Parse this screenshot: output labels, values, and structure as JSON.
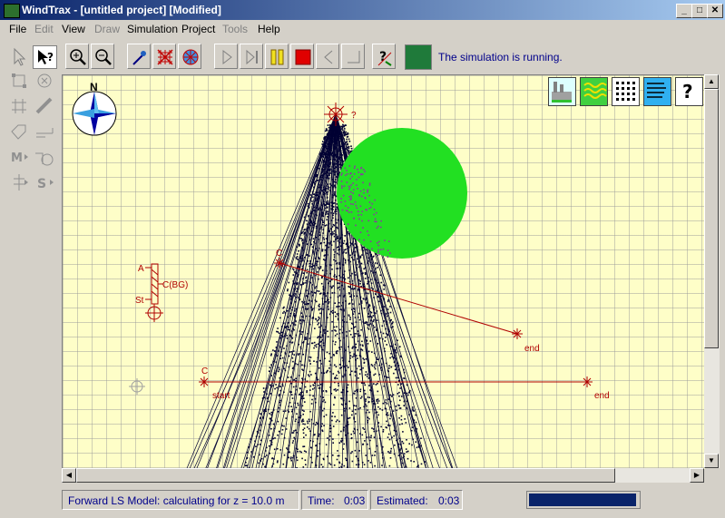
{
  "window": {
    "title": "WindTrax - [untitled project] [Modified]",
    "controls": [
      "_",
      "□",
      "✕"
    ]
  },
  "menu": [
    {
      "label": "File",
      "enabled": true
    },
    {
      "label": "Edit",
      "enabled": false
    },
    {
      "label": "View",
      "enabled": true
    },
    {
      "label": "Draw",
      "enabled": false
    },
    {
      "label": "Simulation",
      "enabled": true
    },
    {
      "label": "Project",
      "enabled": true
    },
    {
      "label": "Tools",
      "enabled": false
    },
    {
      "label": "Help",
      "enabled": true
    }
  ],
  "toolbar": {
    "buttons": [
      "zoom-in-icon",
      "zoom-out-icon",
      "probe-icon",
      "source-grid-icon",
      "sensor-target-icon",
      "play-icon",
      "step-end-icon",
      "pause-icon",
      "stop-icon",
      "step-back-icon",
      "end-icon",
      "help-cursor-icon"
    ],
    "status_message": "The simulation is running.",
    "status_color": "#1f7a3a"
  },
  "left_tools": [
    "select-icon",
    "select-help-icon",
    "resize-icon",
    "rotate-icon",
    "grid-icon",
    "ruler-icon",
    "tag-icon",
    "sensor-line-icon",
    "m-icon",
    "s-circle-icon",
    "tower-icon",
    "s-icon"
  ],
  "compass": {
    "label": "N"
  },
  "canvas_labels": {
    "tower_a": "A",
    "tower_st": "St",
    "tower_cbg": "C(BG)",
    "sensor1_c": "C",
    "sensor2_c": "C",
    "sensor2_start": "start",
    "sensor1_end": "end",
    "sensor2_end": "end",
    "source_q": "?"
  },
  "colors": {
    "canvas_bg": "#fefec8",
    "source_green": "#22e022",
    "marker_red": "#b00000",
    "trajectory": "#000033"
  },
  "statusbar": {
    "message": "Forward LS Model: calculating for z = 10.0 m",
    "time_label": "Time:",
    "time_value": "0:03",
    "estimated_label": "Estimated:",
    "estimated_value": "0:03",
    "progress": 1.0
  },
  "tag_buttons": [
    "factory-icon",
    "heat-icon",
    "grid-pattern-icon",
    "wind-lines-icon",
    "help-icon"
  ]
}
